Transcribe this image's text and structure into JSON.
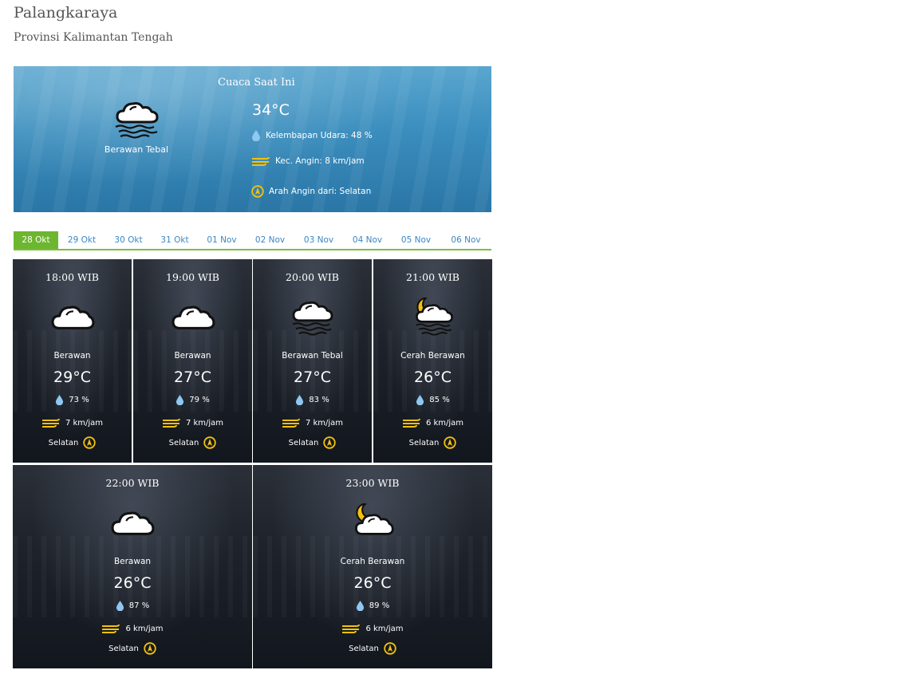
{
  "header": {
    "city": "Palangkaraya",
    "province": "Provinsi Kalimantan Tengah"
  },
  "current": {
    "title": "Cuaca Saat Ini",
    "condition": "Berawan Tebal",
    "icon": "cloud-fog-icon",
    "temp": "34°C",
    "humidity": "Kelembapan Udara: 48 %",
    "wind_speed": "Kec. Angin: 8 km/jam",
    "wind_dir": "Arah Angin dari: Selatan"
  },
  "tabs": [
    {
      "label": "28 Okt",
      "active": true
    },
    {
      "label": "29 Okt"
    },
    {
      "label": "30 Okt"
    },
    {
      "label": "31 Okt"
    },
    {
      "label": "01 Nov"
    },
    {
      "label": "02 Nov"
    },
    {
      "label": "03 Nov"
    },
    {
      "label": "04 Nov"
    },
    {
      "label": "05 Nov"
    },
    {
      "label": "06 Nov"
    }
  ],
  "forecast": [
    {
      "time": "18:00 WIB",
      "icon": "cloud-icon",
      "condition": "Berawan",
      "temp": "29°C",
      "humidity": "73 %",
      "wind": "7 km/jam",
      "direction": "Selatan"
    },
    {
      "time": "19:00 WIB",
      "icon": "cloud-icon",
      "condition": "Berawan",
      "temp": "27°C",
      "humidity": "79 %",
      "wind": "7 km/jam",
      "direction": "Selatan"
    },
    {
      "time": "20:00 WIB",
      "icon": "cloud-fog-icon",
      "condition": "Berawan Tebal",
      "temp": "27°C",
      "humidity": "83 %",
      "wind": "7 km/jam",
      "direction": "Selatan"
    },
    {
      "time": "21:00 WIB",
      "icon": "moon-cloud-fog-icon",
      "condition": "Cerah Berawan",
      "temp": "26°C",
      "humidity": "85 %",
      "wind": "6 km/jam",
      "direction": "Selatan"
    },
    {
      "time": "22:00 WIB",
      "icon": "cloud-icon",
      "condition": "Berawan",
      "temp": "26°C",
      "humidity": "87 %",
      "wind": "6 km/jam",
      "direction": "Selatan"
    },
    {
      "time": "23:00 WIB",
      "icon": "moon-cloud-icon",
      "condition": "Cerah Berawan",
      "temp": "26°C",
      "humidity": "89 %",
      "wind": "6 km/jam",
      "direction": "Selatan"
    }
  ],
  "colors": {
    "accent_green": "#6db62f",
    "tab_text": "#3b86c6",
    "icon_yellow": "#f4c20d",
    "drop_blue": "#8ec8f0"
  }
}
